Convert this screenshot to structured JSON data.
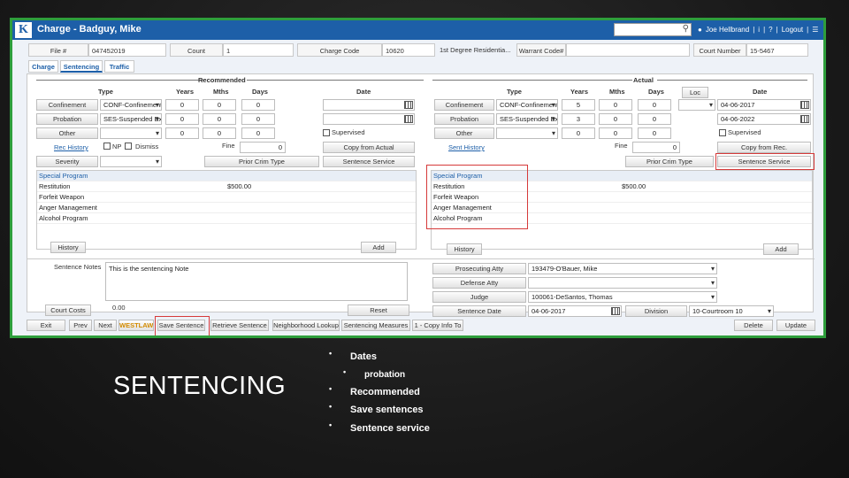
{
  "window": {
    "title": "Charge - Badguy, Mike",
    "logo": "K",
    "user": "Joe Hellbrand",
    "logout": "Logout",
    "info_glyph": "i",
    "help_glyph": "?"
  },
  "header": {
    "file_label": "File #",
    "file_value": "047452019",
    "count_label": "Count",
    "count_value": "1",
    "charge_code_label": "Charge Code",
    "charge_code_value": "10620",
    "charge_desc": "1st Degree Residentia...",
    "warrant_label": "Warrant Code#",
    "warrant_value": "",
    "court_number_label": "Court Number",
    "court_number_value": "15-5467"
  },
  "tabs": [
    "Charge",
    "Sentencing",
    "Traffic"
  ],
  "recommended": {
    "header": "Recommended",
    "col_type": "Type",
    "col_years": "Years",
    "col_mths": "Mths",
    "col_days": "Days",
    "col_date": "Date",
    "rows": [
      {
        "label": "Confinement",
        "type": "CONF-Confinement",
        "years": "0",
        "mths": "0",
        "days": "0",
        "date": ""
      },
      {
        "label": "Probation",
        "type": "SES-Suspended Exec",
        "years": "0",
        "mths": "0",
        "days": "0",
        "date": ""
      },
      {
        "label": "Other",
        "type": "",
        "years": "0",
        "mths": "0",
        "days": "0",
        "supervised": "Supervised"
      }
    ],
    "rec_history": "Rec History",
    "np": "NP",
    "dismiss": "Dismiss",
    "fine_label": "Fine",
    "fine_value": "0",
    "copy_from_actual": "Copy from Actual",
    "severity": "Severity",
    "prior_crim_type": "Prior Crim Type",
    "sentence_service": "Sentence Service",
    "special_program": "Special Program",
    "programs": [
      {
        "name": "Restitution",
        "amount": "$500.00"
      },
      {
        "name": "Forfeit Weapon",
        "amount": ""
      },
      {
        "name": "Anger Management",
        "amount": ""
      },
      {
        "name": "Alcohol Program",
        "amount": ""
      }
    ],
    "history": "History",
    "add": "Add"
  },
  "actual": {
    "header": "Actual",
    "col_type": "Type",
    "col_years": "Years",
    "col_mths": "Mths",
    "col_days": "Days",
    "col_loc": "Loc",
    "col_date": "Date",
    "rows": [
      {
        "label": "Confinement",
        "type": "CONF-Confinement",
        "years": "5",
        "mths": "0",
        "days": "0",
        "date": "04-06-2017"
      },
      {
        "label": "Probation",
        "type": "SES-Suspended Exec",
        "years": "3",
        "mths": "0",
        "days": "0",
        "date": "04-06-2022"
      },
      {
        "label": "Other",
        "type": "",
        "years": "0",
        "mths": "0",
        "days": "0",
        "supervised": "Supervised"
      }
    ],
    "sent_history": "Sent History",
    "fine_label": "Fine",
    "fine_value": "0",
    "copy_from_rec": "Copy from Rec.",
    "prior_crim_type": "Prior Crim Type",
    "sentence_service": "Sentence Service",
    "special_program": "Special Program",
    "programs": [
      {
        "name": "Restitution",
        "amount": "$500.00"
      },
      {
        "name": "Forfeit Weapon",
        "amount": ""
      },
      {
        "name": "Anger Management",
        "amount": ""
      },
      {
        "name": "Alcohol Program",
        "amount": ""
      }
    ],
    "history": "History",
    "add": "Add"
  },
  "notes": {
    "label": "Sentence Notes",
    "text": "This is the sentencing Note",
    "court_costs": "Court Costs",
    "court_costs_value": "0.00",
    "reset": "Reset"
  },
  "assignment": {
    "prosecuting_label": "Prosecuting Atty",
    "prosecuting_value": "193479-O'Bauer, Mike",
    "defense_label": "Defense Atty",
    "defense_value": "",
    "judge_label": "Judge",
    "judge_value": "100061-DeSantos, Thomas",
    "sentence_date_label": "Sentence Date",
    "sentence_date_value": "04-06-2017",
    "division_label": "Division",
    "division_value": "10-Courtroom 10"
  },
  "footer": {
    "exit": "Exit",
    "prev": "Prev",
    "next": "Next",
    "westlaw": "WESTLAW",
    "save_sentence": "Save Sentence",
    "retrieve_sentence": "Retrieve Sentence",
    "neighborhood_lookup": "Neighborhood Lookup",
    "sentencing_measures": "Sentencing Measures",
    "copy_info": "1 - Copy Info To",
    "delete": "Delete",
    "update": "Update"
  },
  "slide": {
    "title": "SENTENCING",
    "bullets": [
      {
        "text": "Dates",
        "level": 1
      },
      {
        "text": "probation",
        "level": 2
      },
      {
        "text": "Recommended",
        "level": 1
      },
      {
        "text": "Save sentences",
        "level": 1
      },
      {
        "text": "Sentence service",
        "level": 1
      }
    ]
  },
  "colors": {
    "accent_blue": "#1d5fa8",
    "frame_green": "#2e9e3c",
    "highlight_red": "#d63a3a"
  }
}
